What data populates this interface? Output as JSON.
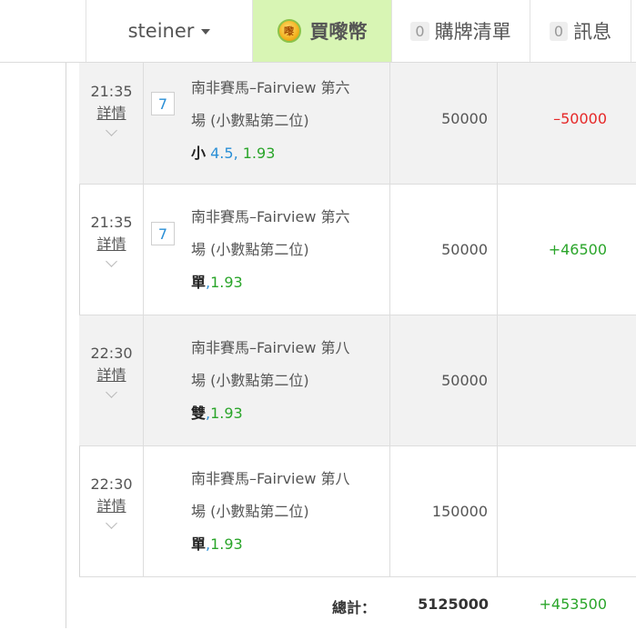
{
  "header": {
    "username": "steiner",
    "coins_label": "買嚟幣",
    "coin_icon_text": "嚟",
    "cart_count": "0",
    "cart_label": "購牌清單",
    "msg_count": "0",
    "msg_label": "訊息"
  },
  "rows": [
    {
      "time": "21:35",
      "detail": "詳情",
      "badge": "7",
      "event_line1": "南非賽馬–Fairview 第六",
      "event_line2": "場 (小數點第二位)",
      "selection": "小",
      "line": "4.5",
      "odds": "1.93",
      "sep": ",",
      "stake": "50000",
      "result": "–50000"
    },
    {
      "time": "21:35",
      "detail": "詳情",
      "badge": "7",
      "event_line1": "南非賽馬–Fairview 第六",
      "event_line2": "場 (小數點第二位)",
      "selection": "單",
      "odds": "1.93",
      "sep": ",",
      "stake": "50000",
      "result": "+46500"
    },
    {
      "time": "22:30",
      "detail": "詳情",
      "event_line1": "南非賽馬–Fairview 第八",
      "event_line2": "場 (小數點第二位)",
      "selection": "雙",
      "odds": "1.93",
      "sep": ",",
      "stake": "50000",
      "result": ""
    },
    {
      "time": "22:30",
      "detail": "詳情",
      "event_line1": "南非賽馬–Fairview 第八",
      "event_line2": "場 (小數點第二位)",
      "selection": "單",
      "odds": "1.93",
      "sep": ",",
      "stake": "150000",
      "result": ""
    }
  ],
  "totals": {
    "label": "總計：",
    "stake": "5125000",
    "result": "+453500"
  },
  "colors": {
    "coins_bg": "#d8f5b4",
    "loss": "#e62828",
    "win": "#2aa52a",
    "line_blue": "#2a8fd6",
    "alt_row": "#f2f2f2"
  }
}
